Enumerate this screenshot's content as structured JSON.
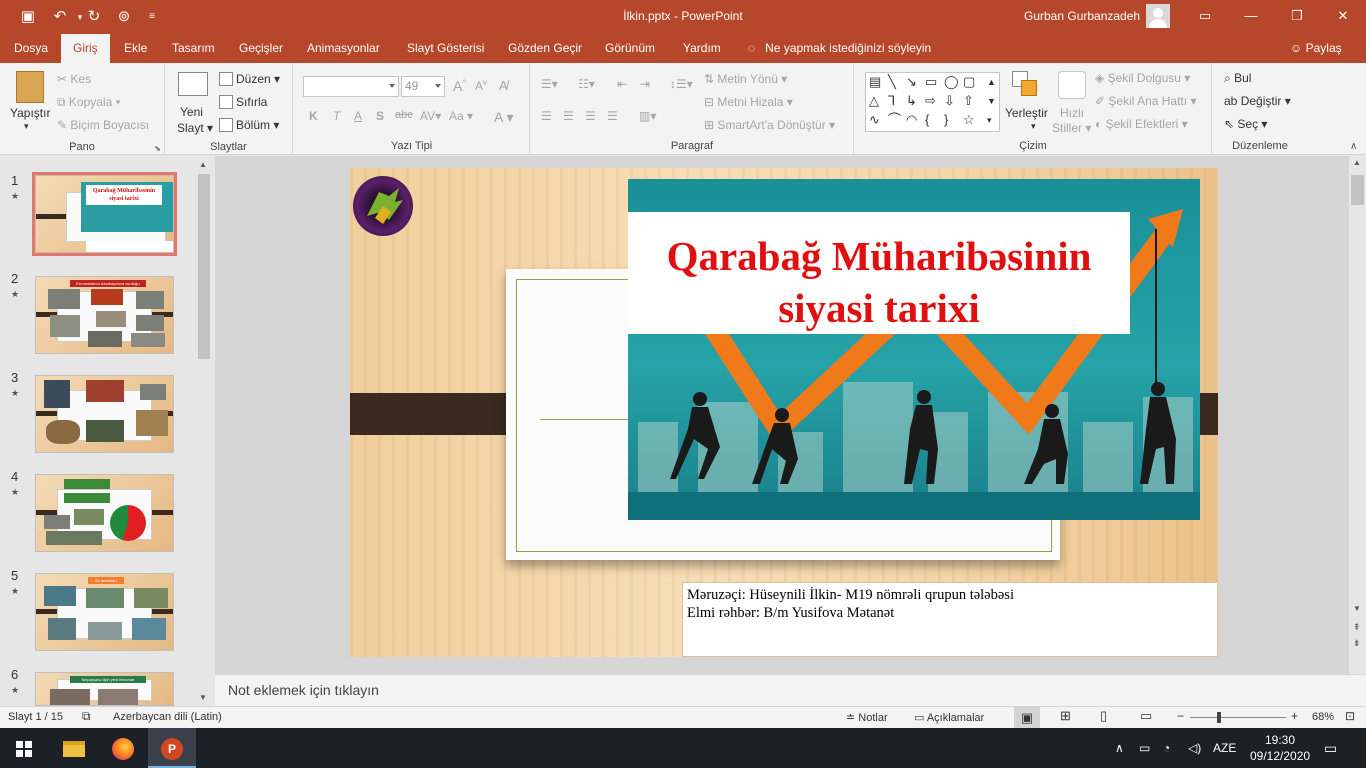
{
  "window": {
    "title": "İlkin.pptx  -  PowerPoint",
    "user": "Gurban Gurbanzadeh"
  },
  "tabs": [
    "Dosya",
    "Giriş",
    "Ekle",
    "Tasarım",
    "Geçişler",
    "Animasyonlar",
    "Slayt Gösterisi",
    "Gözden Geçir",
    "Görünüm",
    "Yardım"
  ],
  "active_tab": "Giriş",
  "tell_me": "Ne yapmak istediğinizi söyleyin",
  "share": "Paylaş",
  "ribbon": {
    "pano": {
      "label": "Pano",
      "paste": "Yapıştır",
      "cut": "Kes",
      "copy": "Kopyala",
      "format_painter": "Biçim Boyacısı"
    },
    "slaytlar": {
      "label": "Slaytlar",
      "new_slide_1": "Yeni",
      "new_slide_2": "Slayt",
      "layout": "Düzen",
      "reset": "Sıfırla",
      "section": "Bölüm"
    },
    "yazi_tipi": {
      "label": "Yazı Tipi",
      "font_name": "",
      "font_size": "49",
      "bold": "K",
      "italic": "T",
      "underline": "A",
      "shadow": "S",
      "strike": "abc",
      "aa": "Aa",
      "fontcolor": "A"
    },
    "paragraf": {
      "label": "Paragraf",
      "text_direction": "Metin Yönü",
      "align_text": "Metni Hizala",
      "smartart": "SmartArt'a Dönüştür"
    },
    "cizim": {
      "label": "Çizim",
      "arrange": "Yerleştir",
      "quick_styles_1": "Hızlı",
      "quick_styles_2": "Stiller",
      "fill": "Şekil Dolgusu",
      "outline": "Şekil Ana Hattı",
      "effects": "Şekil Efektleri"
    },
    "duzenleme": {
      "label": "Düzenleme",
      "find": "Bul",
      "replace": "Değiştir",
      "select": "Seç"
    }
  },
  "thumbnails": [
    "1",
    "2",
    "3",
    "4",
    "5",
    "6"
  ],
  "thumb_titles": [
    "Qarabağ Müharibəsinin siyasi tarixi",
    "Ermənistanın Azərbaycana vurduğu zərərlər",
    "",
    "",
    "Su anbarları",
    "Neçəyşənə ilçin yenl imkanlar"
  ],
  "slide": {
    "title_line1": "Qarabağ Müharibəsinin",
    "title_line2": "siyasi tarixi",
    "subtitle_line1": "Məruzəçi: Hüseynili İlkin- M19 nömrəli qrupun tələbəsi",
    "subtitle_line2": "Elmi rəhbər: B/m Yusifova Mətanət",
    "title_color": "#e01010"
  },
  "notes_placeholder": "Not eklemek için tıklayın",
  "status": {
    "slide_counter": "Slayt 1 / 15",
    "language": "Azerbaycan dili (Latin)",
    "notes": "Notlar",
    "comments": "Açıklamalar",
    "zoom": "68%",
    "zoom_minus": "−",
    "zoom_plus": "+"
  },
  "taskbar": {
    "lang": "AZE",
    "time": "19:30",
    "date": "09/12/2020"
  }
}
